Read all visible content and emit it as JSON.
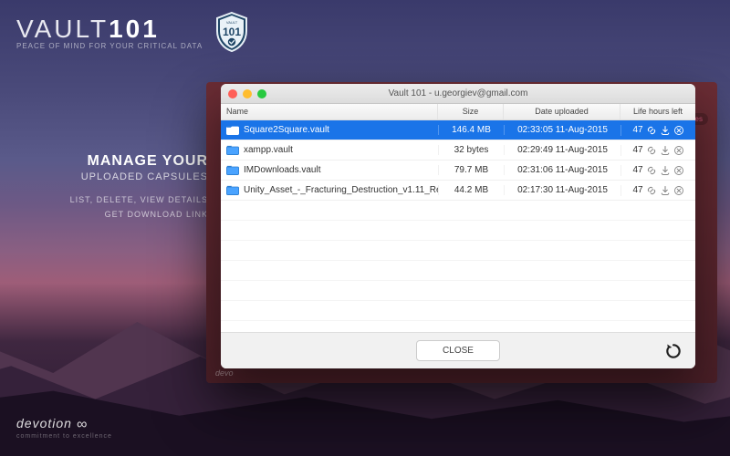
{
  "brand": {
    "name_a": "VAULT",
    "name_b": "101",
    "tagline": "PEACE OF MIND FOR YOUR CRITICAL DATA",
    "shield_top": "VAULT",
    "shield_num": "101"
  },
  "hero": {
    "line1": "MANAGE YOUR",
    "line2": "UPLOADED CAPSULES",
    "sub1": "LIST, DELETE, VIEW DETAILS",
    "sub2": "GET DOWNLOAD LINK"
  },
  "footer": {
    "brand": "devotion",
    "tag": "commitment to excellence"
  },
  "back_panel": {
    "footer": "devo",
    "pill": "ules"
  },
  "window": {
    "title": "Vault 101 - u.georgiev@gmail.com",
    "close": "CLOSE",
    "columns": {
      "name": "Name",
      "size": "Size",
      "date": "Date uploaded",
      "life": "Life hours left"
    },
    "rows": [
      {
        "name": "Square2Square.vault",
        "size": "146.4 MB",
        "date": "02:33:05 11-Aug-2015",
        "life": "47",
        "selected": true
      },
      {
        "name": "xampp.vault",
        "size": "32 bytes",
        "date": "02:29:49 11-Aug-2015",
        "life": "47",
        "selected": false
      },
      {
        "name": "IMDownloads.vault",
        "size": "79.7 MB",
        "date": "02:31:06 11-Aug-2015",
        "life": "47",
        "selected": false
      },
      {
        "name": "Unity_Asset_-_Fracturing_Destruction_v1.11_Re...",
        "size": "44.2 MB",
        "date": "02:17:30 11-Aug-2015",
        "life": "47",
        "selected": false
      }
    ]
  }
}
